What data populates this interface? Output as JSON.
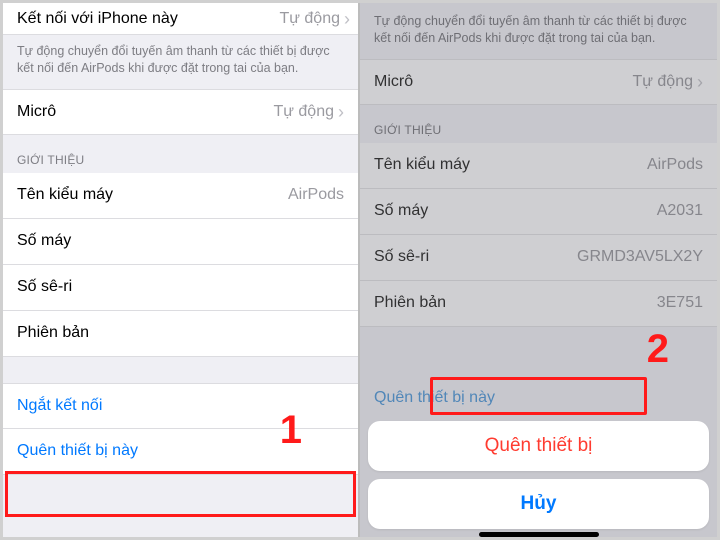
{
  "left": {
    "connect_row": {
      "label": "Kết nối với iPhone này",
      "value": "Tự động"
    },
    "description": "Tự động chuyển đổi tuyến âm thanh từ các thiết bị được kết nối đến AirPods khi được đặt trong tai của bạn.",
    "micro": {
      "label": "Micrô",
      "value": "Tự động"
    },
    "about_header": "GIỚI THIỆU",
    "about": {
      "model_label": "Tên kiểu máy",
      "model_value": "AirPods",
      "number_label": "Số máy",
      "number_value": "",
      "serial_label": "Số sê-ri",
      "serial_value": "",
      "version_label": "Phiên bản",
      "version_value": ""
    },
    "disconnect": "Ngắt kết nối",
    "forget": "Quên thiết bị này",
    "step": "1"
  },
  "right": {
    "description": "Tự động chuyển đổi tuyến âm thanh từ các thiết bị được kết nối đến AirPods khi được đặt trong tai của bạn.",
    "micro": {
      "label": "Micrô",
      "value": "Tự động"
    },
    "about_header": "GIỚI THIỆU",
    "about": {
      "model_label": "Tên kiểu máy",
      "model_value": "AirPods",
      "number_label": "Số máy",
      "number_value": "A2031",
      "serial_label": "Số sê-ri",
      "serial_value": "GRMD3AV5LX2Y",
      "version_label": "Phiên bản",
      "version_value": "3E751"
    },
    "ghost_forget": "Quên thiết bị này",
    "sheet_forget": "Quên thiết bị",
    "sheet_cancel": "Hủy",
    "step": "2"
  }
}
